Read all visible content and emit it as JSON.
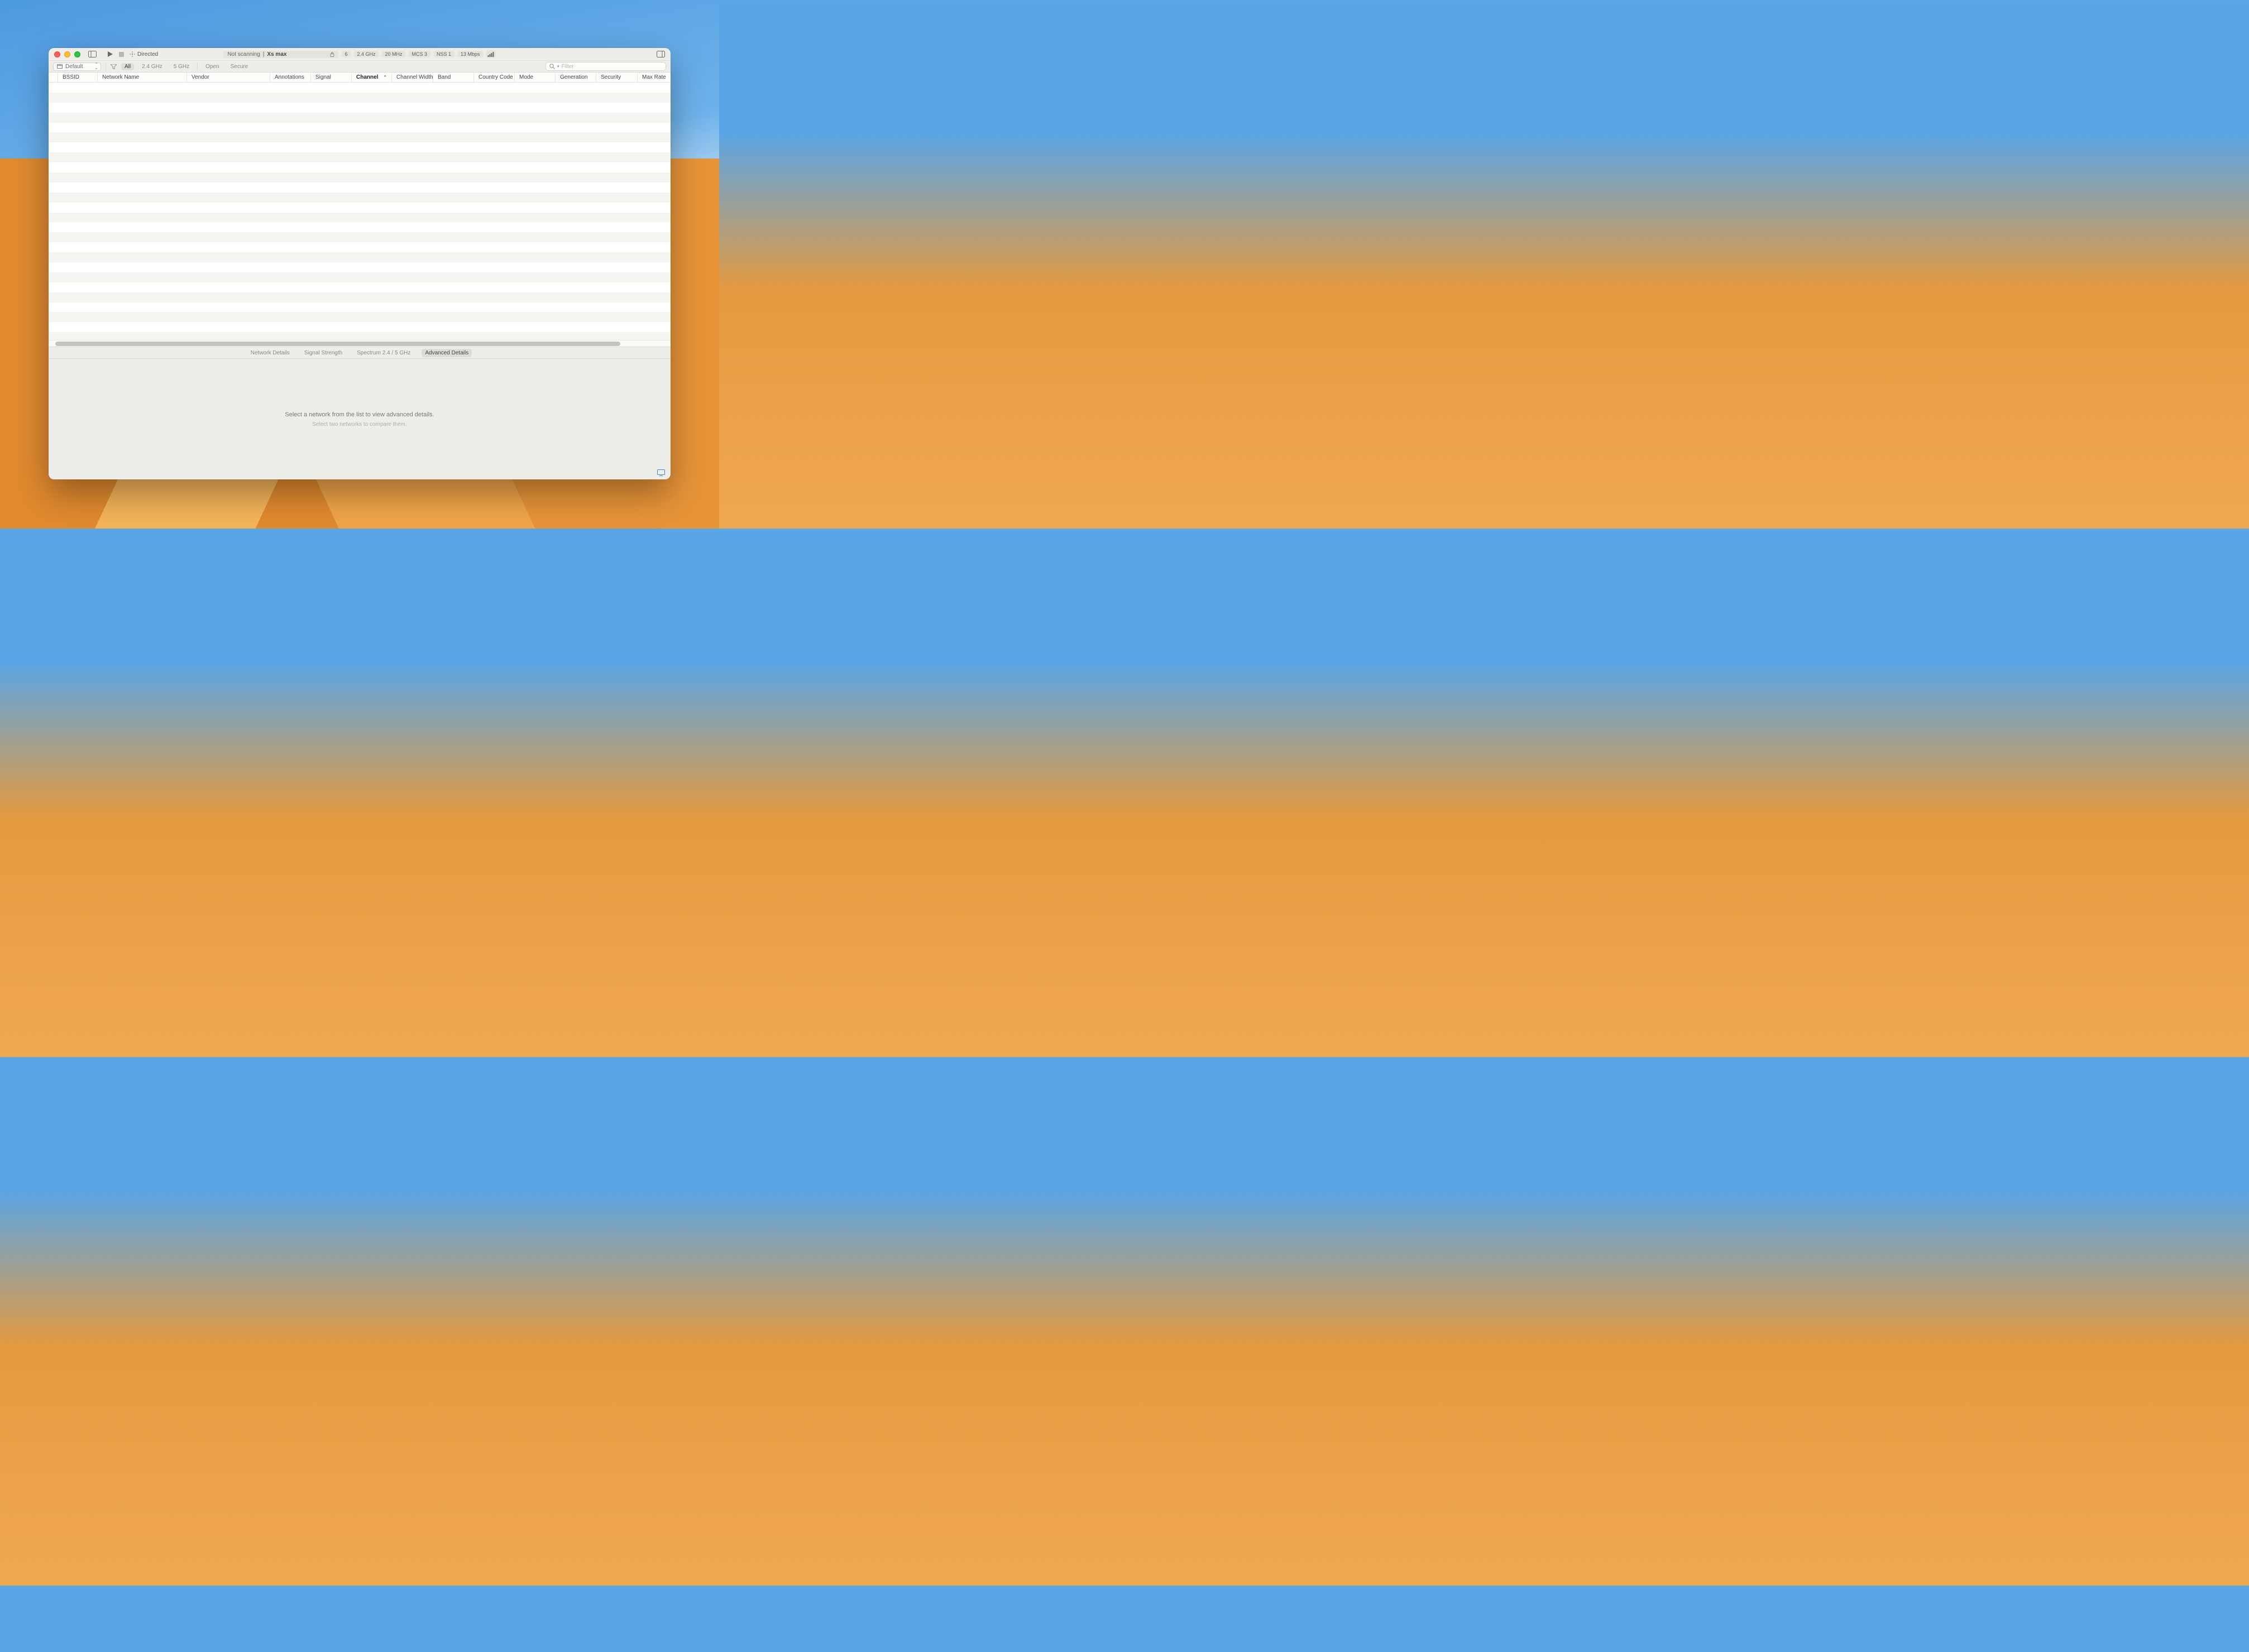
{
  "toolbar": {
    "directed_label": "Directed"
  },
  "status": {
    "scanning_text": "Not scanning",
    "separator": "|",
    "device": "Xs max",
    "badges": [
      "6",
      "2.4 GHz",
      "20 MHz",
      "MCS 3",
      "NSS 1",
      "13 Mbps"
    ]
  },
  "filterbar": {
    "preset": "Default",
    "band_segments": {
      "all": "All",
      "g24": "2.4 GHz",
      "g5": "5 GHz"
    },
    "security_segments": {
      "open": "Open",
      "secure": "Secure"
    },
    "search_placeholder": "Filter"
  },
  "columns": [
    {
      "key": "bssid",
      "label": "BSSID",
      "width": 71
    },
    {
      "key": "network_name",
      "label": "Network Name",
      "width": 160
    },
    {
      "key": "vendor",
      "label": "Vendor",
      "width": 149
    },
    {
      "key": "annotations",
      "label": "Annotations",
      "width": 73
    },
    {
      "key": "signal",
      "label": "Signal",
      "width": 73
    },
    {
      "key": "channel",
      "label": "Channel",
      "width": 72,
      "sorted": "asc"
    },
    {
      "key": "channel_width",
      "label": "Channel Width",
      "width": 74
    },
    {
      "key": "band",
      "label": "Band",
      "width": 73
    },
    {
      "key": "country_code",
      "label": "Country Code",
      "width": 73
    },
    {
      "key": "mode",
      "label": "Mode",
      "width": 73
    },
    {
      "key": "generation",
      "label": "Generation",
      "width": 73
    },
    {
      "key": "security",
      "label": "Security",
      "width": 74
    },
    {
      "key": "max_rate",
      "label": "Max Rate",
      "width": 57
    }
  ],
  "detail_tabs": {
    "network_details": "Network Details",
    "signal_strength": "Signal Strength",
    "spectrum": "Spectrum 2.4 / 5 GHz",
    "advanced_details": "Advanced Details"
  },
  "detail_pane": {
    "primary": "Select a network from the list to view advanced details.",
    "secondary": "Select two networks to compare them."
  }
}
